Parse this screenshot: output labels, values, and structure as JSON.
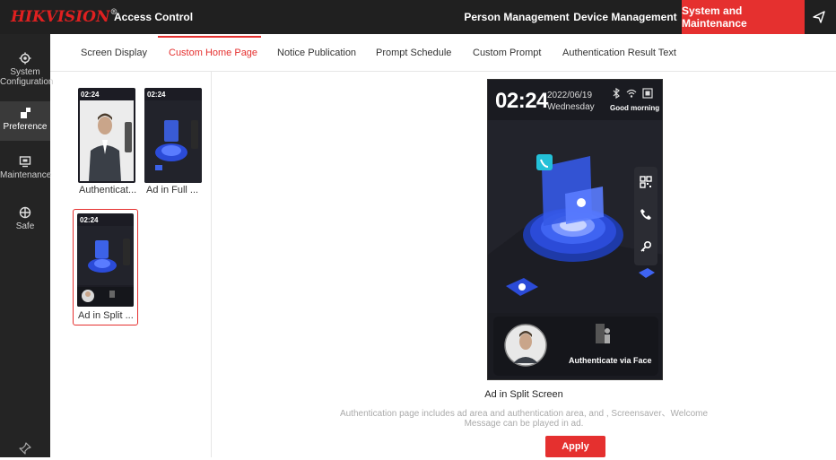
{
  "header": {
    "brand": "HIKVISION",
    "brand_mark": "®",
    "app_name": "Access Control",
    "nav": [
      {
        "label": "Person Management"
      },
      {
        "label": "Device Management"
      },
      {
        "label": "System and Maintenance"
      }
    ],
    "active_nav": "System and Maintenance"
  },
  "sidebar": {
    "items": [
      {
        "label_line1": "System",
        "label_line2": "Configuration",
        "icon": "gear-icon"
      },
      {
        "label_line1": "Preference",
        "icon": "preference-icon"
      },
      {
        "label_line1": "Maintenance",
        "icon": "monitor-icon"
      },
      {
        "label_line1": "Safe",
        "icon": "shield-icon"
      }
    ],
    "active": "Preference",
    "pin_icon": "pin-icon"
  },
  "tabs": {
    "items": [
      {
        "label": "Screen Display"
      },
      {
        "label": "Custom Home Page"
      },
      {
        "label": "Notice Publication"
      },
      {
        "label": "Prompt Schedule"
      },
      {
        "label": "Custom Prompt"
      },
      {
        "label": "Authentication Result Text"
      }
    ],
    "active": "Custom Home Page"
  },
  "templates": [
    {
      "label": "Authenticat...",
      "time": "02:24"
    },
    {
      "label": "Ad in Full ...",
      "time": "02:24"
    },
    {
      "label": "Ad in Split ...",
      "time": "02:24"
    }
  ],
  "selected_template": "Ad in Split ...",
  "preview": {
    "time": "02:24",
    "date": "2022/06/19",
    "weekday": "Wednesday",
    "greeting": "Good morning",
    "auth_text": "Authenticate via Face",
    "status_icons": [
      "bluetooth-icon",
      "wifi-icon",
      "screen-icon"
    ],
    "side_icons": [
      "qr-code-icon",
      "phone-icon",
      "key-icon"
    ]
  },
  "description": {
    "title": "Ad in Split Screen",
    "line1": "Authentication page includes ad area and authentication area, and , Screensaver、Welcome",
    "line2": "Message can be played in ad."
  },
  "apply_label": "Apply",
  "colors": {
    "accent": "#e5302f",
    "topbar": "#202020",
    "sidebar": "#242424"
  }
}
